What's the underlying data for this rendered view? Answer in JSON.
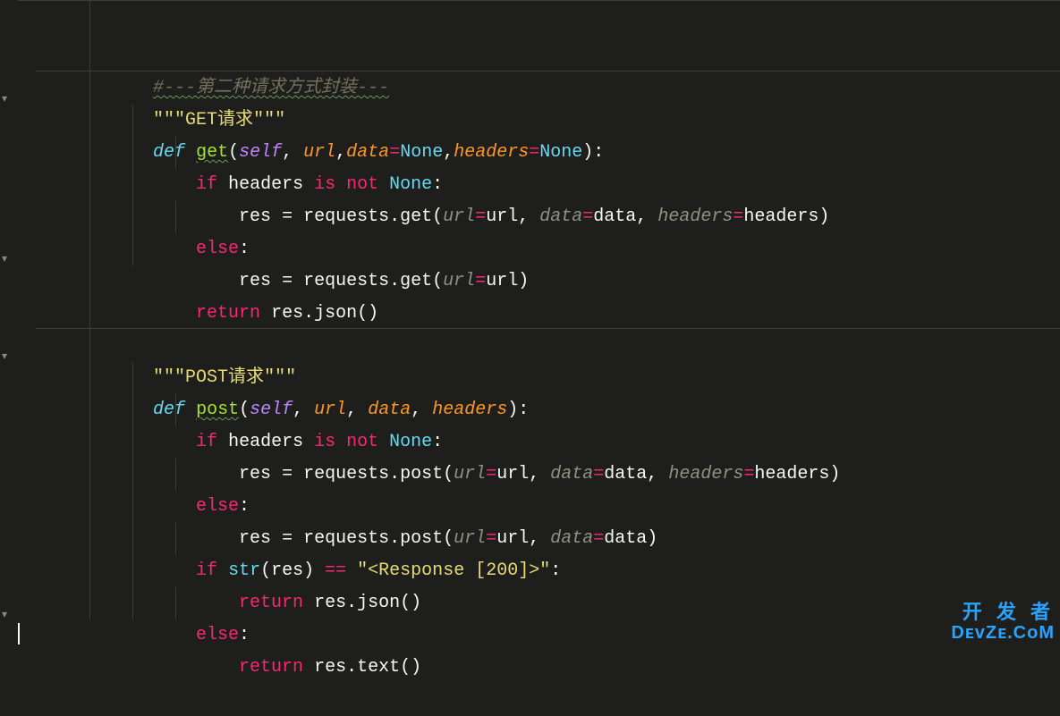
{
  "code": {
    "comment1": "#---第二种请求方式封装---",
    "doc_get_open": "\"\"\"",
    "doc_get_text": "GET请求",
    "doc_get_close": "\"\"\"",
    "def_kw": "def",
    "get_name": "get",
    "self": "self",
    "url": "url",
    "data": "data",
    "headers": "headers",
    "none": "None",
    "if": "if",
    "is": "is",
    "not": "not",
    "else": "else",
    "return": "return",
    "res": "res",
    "requests": "requests",
    "get_call": "get",
    "json_call": "json",
    "post_name": "post",
    "doc_post_open": "\"\"\"",
    "doc_post_text": "POST请求",
    "doc_post_close": "\"\"\"",
    "post_call": "post",
    "str": "str",
    "eqeq": "==",
    "resp200": "\"<Response [200]>\"",
    "text_call": "text",
    "eq": "=",
    "comma": ",",
    "colon": ":",
    "lparen": "(",
    "rparen": ")",
    "dot": "."
  },
  "watermark": {
    "line1": "开 发 者",
    "line2": "DᴇᴠZᴇ.CᴏM"
  }
}
